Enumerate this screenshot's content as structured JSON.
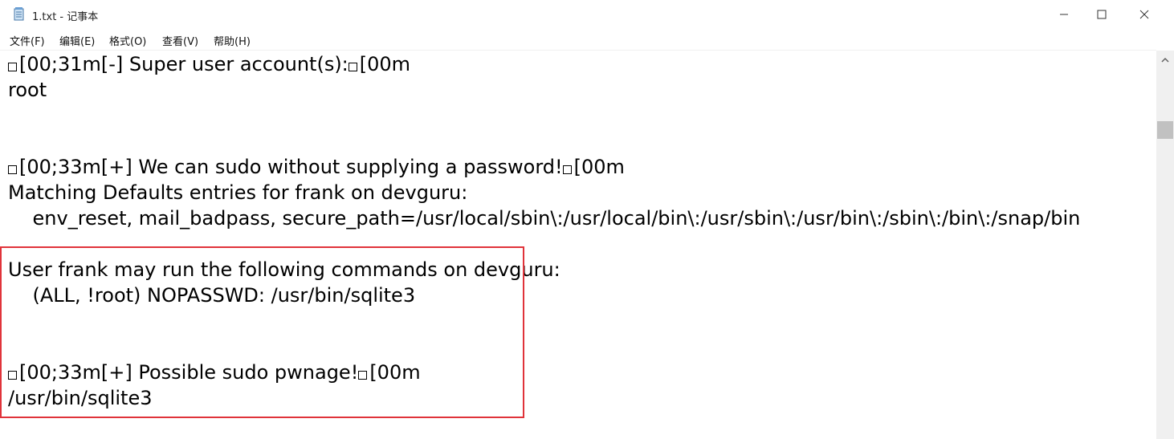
{
  "window": {
    "title": "1.txt - 记事本",
    "icon": "notepad-icon",
    "controls": [
      "minimize-icon",
      "maximize-icon",
      "close-icon"
    ]
  },
  "menu": {
    "file": "文件(F)",
    "edit": "编辑(E)",
    "format": "格式(O)",
    "view": "查看(V)",
    "help": "帮助(H)"
  },
  "editor": {
    "lines": [
      {
        "esc": true,
        "text": "[00;31m[-] Super user account(s):",
        "esc2": true,
        "tail": "[00m"
      },
      {
        "text": "root"
      },
      {
        "text": ""
      },
      {
        "text": ""
      },
      {
        "esc": true,
        "text": "[00;33m[+] We can sudo without supplying a password!",
        "esc2": true,
        "tail": "[00m"
      },
      {
        "text": "Matching Defaults entries for frank on devguru:"
      },
      {
        "text": "    env_reset, mail_badpass, secure_path=/usr/local/sbin\\:/usr/local/bin\\:/usr/sbin\\:/usr/bin\\:/sbin\\:/bin\\:/snap/bin"
      },
      {
        "text": ""
      },
      {
        "text": "User frank may run the following commands on devguru:"
      },
      {
        "text": "    (ALL, !root) NOPASSWD: /usr/bin/sqlite3"
      },
      {
        "text": ""
      },
      {
        "text": ""
      },
      {
        "esc": true,
        "text": "[00;33m[+] Possible sudo pwnage!",
        "esc2": true,
        "tail": "[00m"
      },
      {
        "text": "/usr/bin/sqlite3"
      }
    ]
  },
  "colors": {
    "highlight_border": "#e0333a",
    "scrollbar_track": "#f0f0f0",
    "scrollbar_thumb": "#c1c1c1"
  }
}
